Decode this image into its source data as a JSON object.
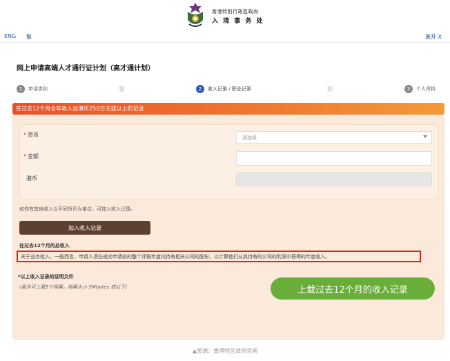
{
  "header": {
    "department_cn": "香港特別行政區政府",
    "department_name": "入 境 事 务 处"
  },
  "lang_bar": {
    "eng": "ENG",
    "trad": "繁",
    "exit": "离开 X"
  },
  "page_title": "网上申请高端人才通行证计划（高才通计划）",
  "steps": [
    {
      "num": "1",
      "label": "申请类别"
    },
    {
      "num": "2",
      "label": "收入记录 / 职业记录"
    },
    {
      "num": "3",
      "label": "个人资料"
    }
  ],
  "step_arrow": "》》",
  "banner": "在过去12个月全年收入达港币250万元或以上的记录",
  "form": {
    "currency_label": "货币",
    "currency_placeholder": "请选择",
    "amount_label": "金额",
    "hkd_label": "港币"
  },
  "hint": "如你有其他收入以不同货币为单位，可加入收入记录。",
  "add_button": "加入收入记录",
  "total": {
    "title": "在过去12个月的总收入",
    "note": "关于业务收入，一般而言，申请人须在递交申请前的整个评税年度内持有相关公司的股份，以计算他们从其持有的公司的利润中获得的年度收入。"
  },
  "upload": {
    "title": "*以上收入记录的证明文件",
    "note": "(最多可上载5个档案，档案大小 5Mbytes 或以下)"
  },
  "green_button": "上载过去12个月的收入记录",
  "source": "▲图源：香港特区政府官网",
  "colors": {
    "banner": "#ee7a30",
    "add_button": "#5c4030",
    "green_button": "#6aae3a",
    "highlight_box": "#e0231c",
    "active_step": "#2b5fa7"
  }
}
